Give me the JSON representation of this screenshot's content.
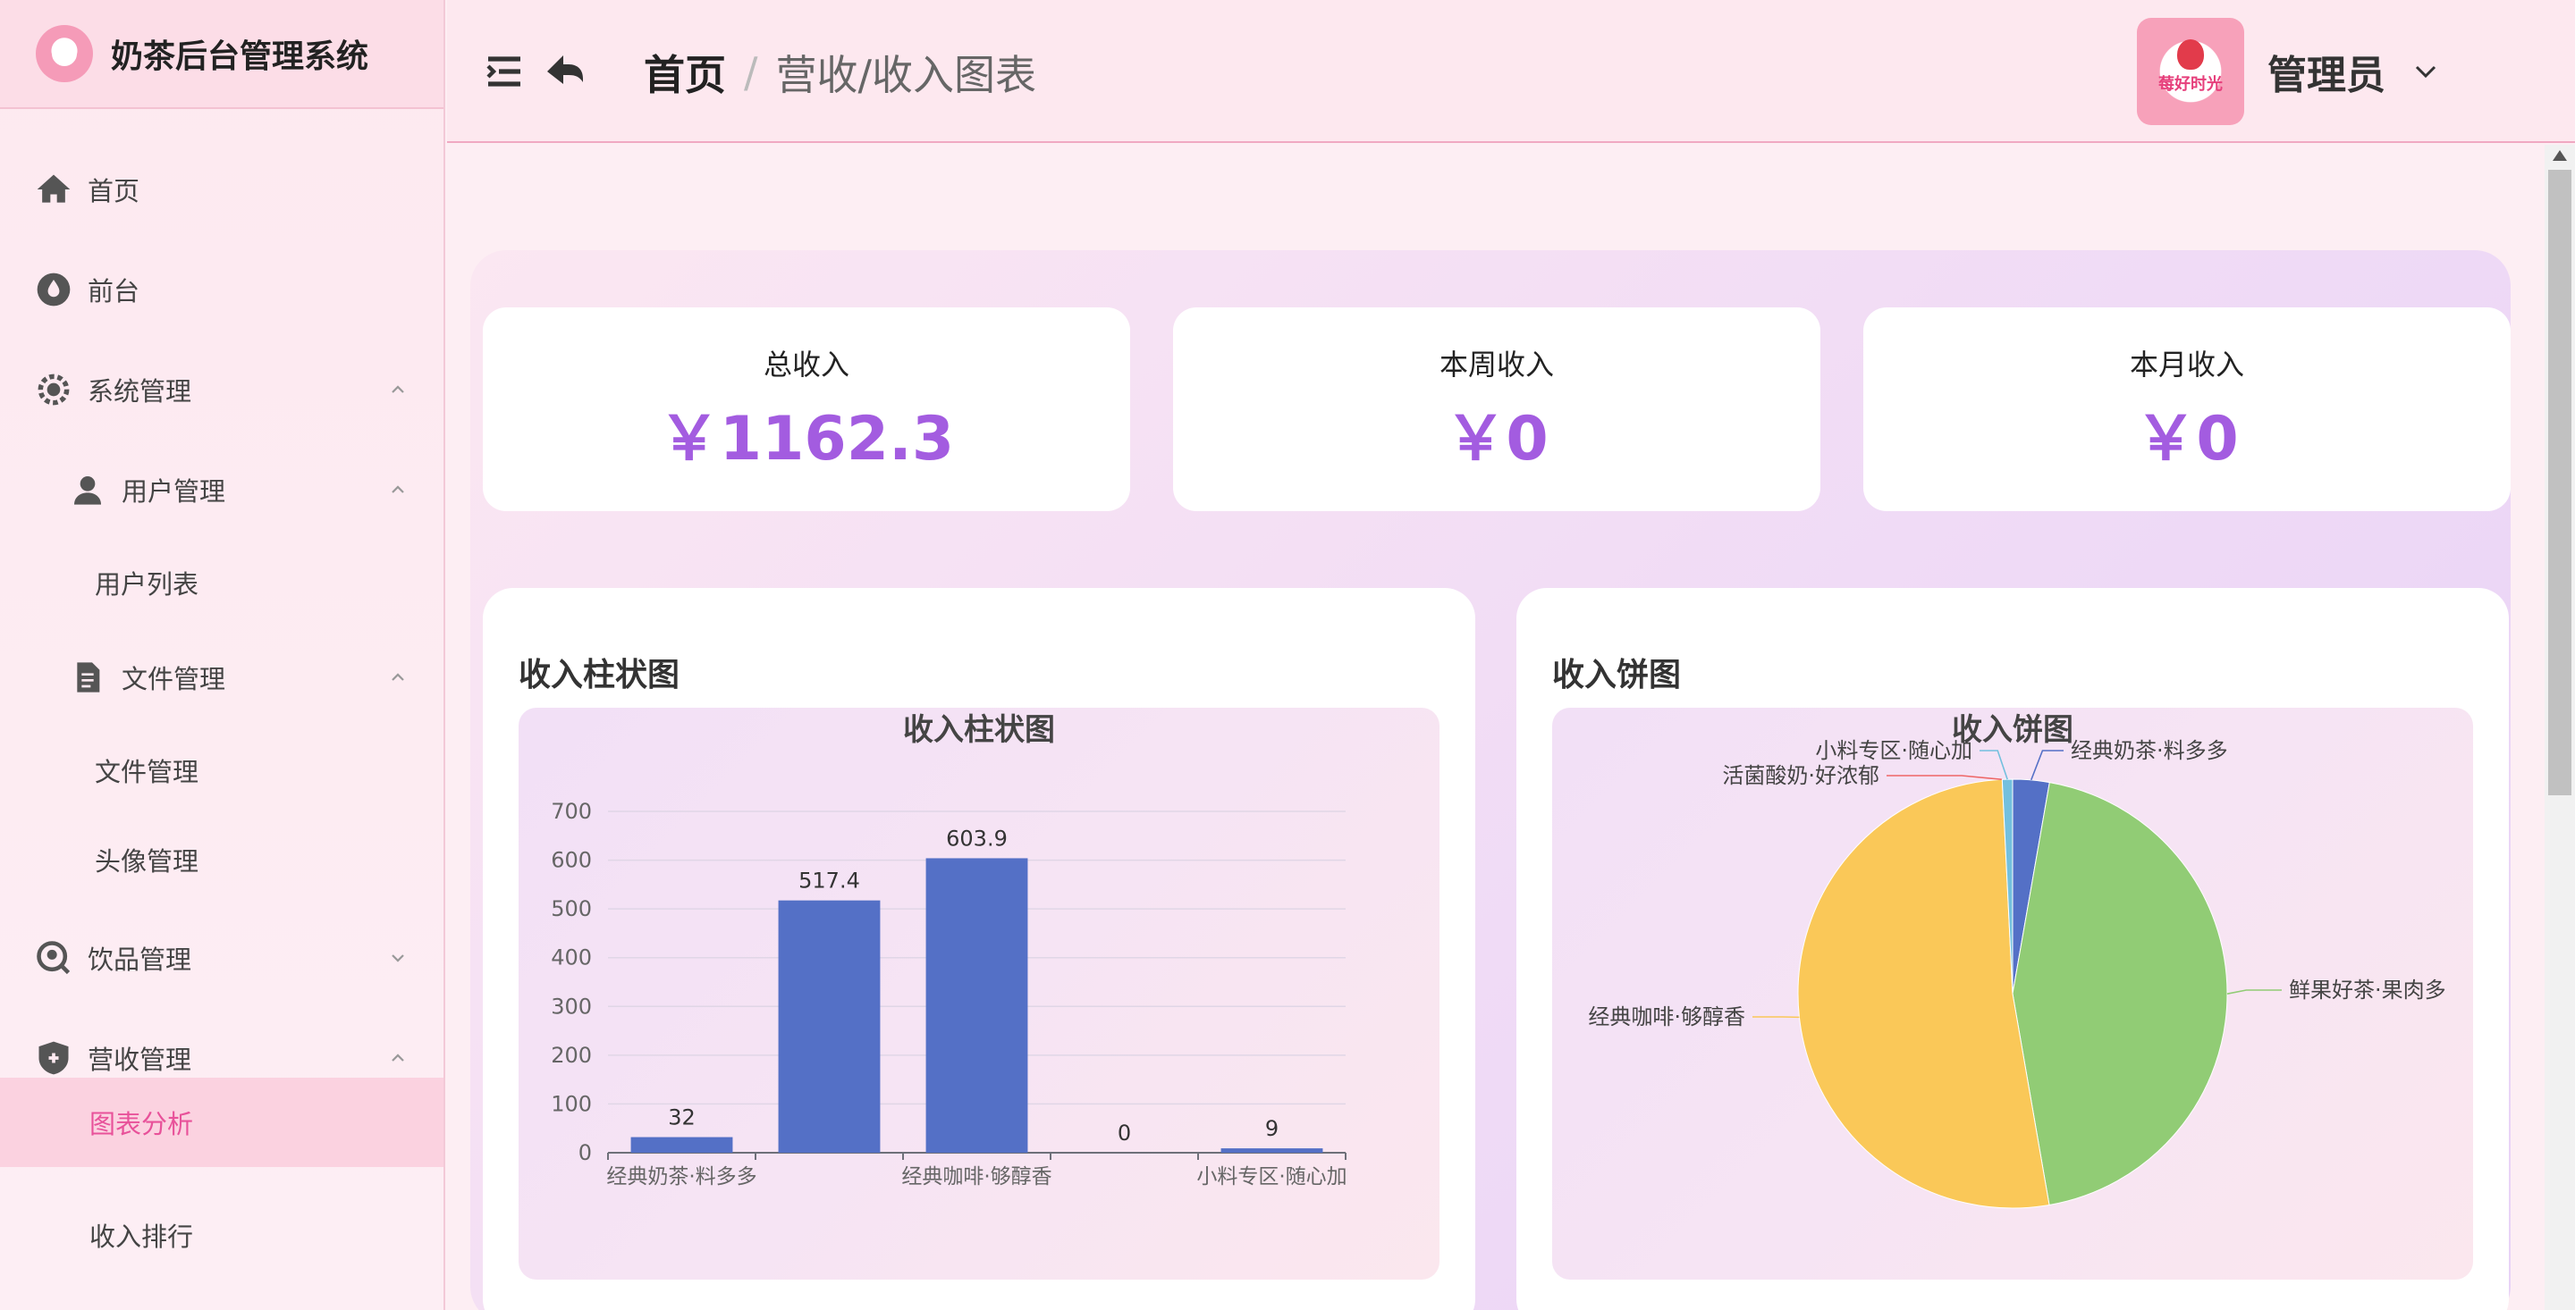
{
  "app": {
    "title": "奶茶后台管理系统",
    "logo_icon": "milk-tea-logo-icon"
  },
  "sidebar": {
    "items": [
      {
        "label": "首页",
        "icon": "home-icon"
      },
      {
        "label": "前台",
        "icon": "drop-icon"
      },
      {
        "label": "系统管理",
        "icon": "gear-icon",
        "expanded": true
      },
      {
        "label": "用户管理",
        "icon": "user-icon",
        "expanded": true
      },
      {
        "label": "用户列表"
      },
      {
        "label": "文件管理",
        "icon": "document-icon",
        "expanded": true
      },
      {
        "label": "文件管理"
      },
      {
        "label": "头像管理"
      },
      {
        "label": "饮品管理",
        "icon": "search-icon",
        "expanded": false
      },
      {
        "label": "营收管理",
        "icon": "shield-icon",
        "expanded": true
      },
      {
        "label": "图表分析",
        "active": true
      },
      {
        "label": "收入排行"
      }
    ]
  },
  "header": {
    "breadcrumb": {
      "home": "首页",
      "separator": "/",
      "current": "营收/收入图表"
    },
    "avatar_text": "莓好时光",
    "user_name": "管理员"
  },
  "stats": [
    {
      "label": "总收入",
      "value": "￥1162.3"
    },
    {
      "label": "本周收入",
      "value": "￥0"
    },
    {
      "label": "本月收入",
      "value": "￥0"
    }
  ],
  "colors": {
    "accent": "#a35ce0",
    "active_menu": "#e8529a",
    "bar": "#5470c6"
  },
  "chart_data": [
    {
      "type": "bar",
      "card_title": "收入柱状图",
      "title": "收入柱状图",
      "categories": [
        "经典奶茶·料多多",
        "鲜果好茶·果肉多",
        "经典咖啡·够醇香",
        "活菌酸奶·好浓郁",
        "小料专区·随心加"
      ],
      "tick_labels": [
        "经典奶茶·料多多",
        "经典咖啡·够醇香",
        "小料专区·随心加"
      ],
      "values": [
        32,
        517.4,
        603.9,
        0,
        9
      ],
      "value_labels": [
        "32",
        "517.4",
        "603.9",
        "0",
        "9"
      ],
      "ylim": [
        0,
        700
      ],
      "yticks": [
        "0",
        "100",
        "200",
        "300",
        "400",
        "500",
        "600",
        "700"
      ],
      "grid": true
    },
    {
      "type": "pie",
      "card_title": "收入饼图",
      "title": "收入饼图",
      "slices": [
        {
          "name": "经典奶茶·料多多",
          "value": 32,
          "color": "#5470c6"
        },
        {
          "name": "鲜果好茶·果肉多",
          "value": 517.4,
          "color": "#91cc75"
        },
        {
          "name": "经典咖啡·够醇香",
          "value": 603.9,
          "color": "#fac858"
        },
        {
          "name": "活菌酸奶·好浓郁",
          "value": 0,
          "color": "#ee6666"
        },
        {
          "name": "小料专区·随心加",
          "value": 9,
          "color": "#73c0de"
        }
      ]
    }
  ]
}
